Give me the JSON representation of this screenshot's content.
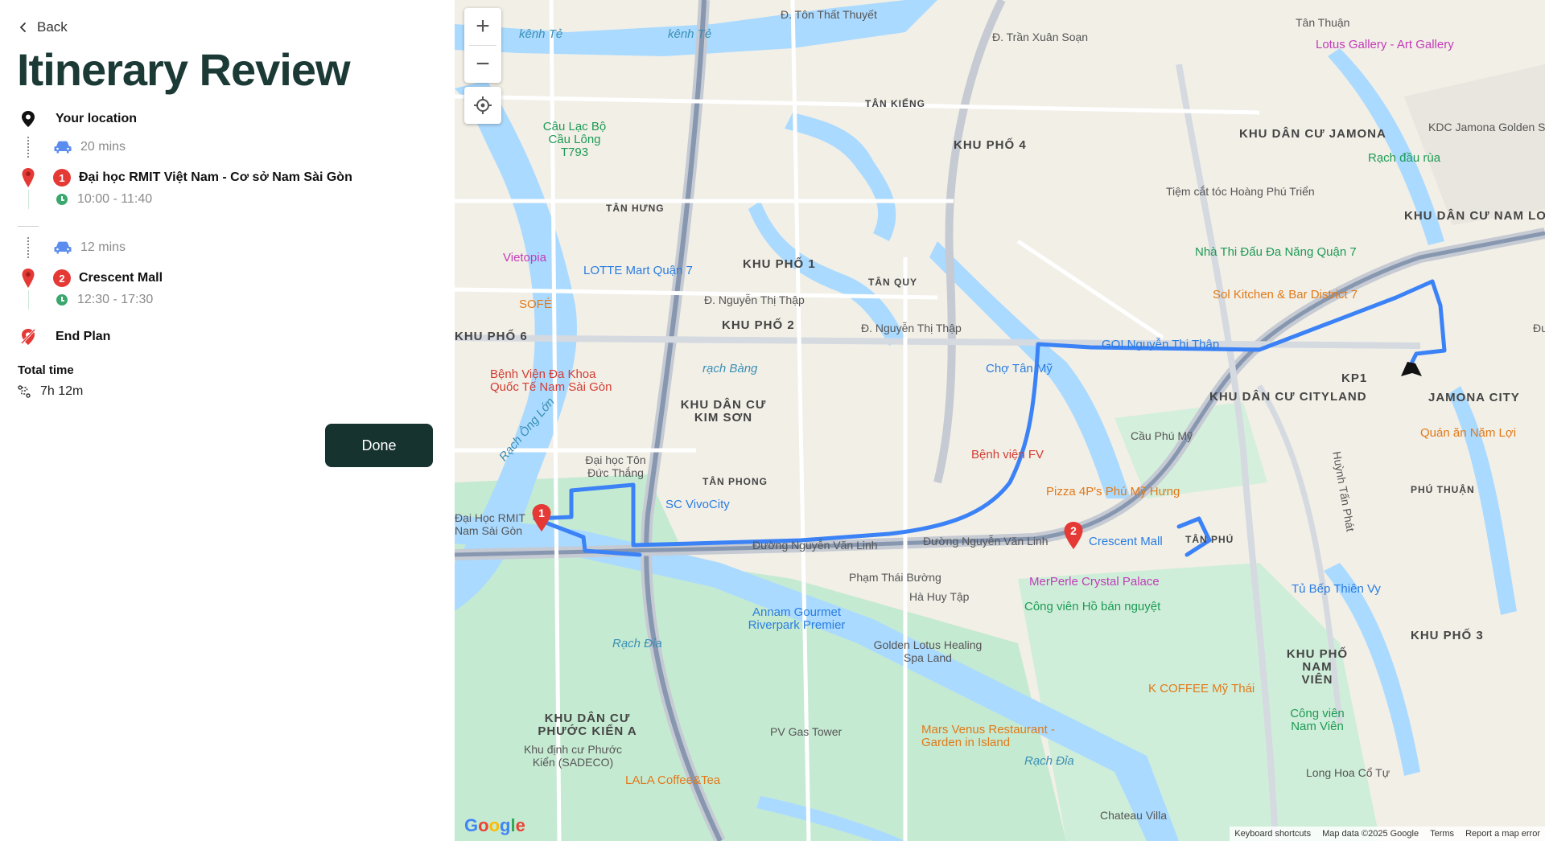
{
  "header": {
    "back_label": "Back",
    "title": "Itinerary Review"
  },
  "itinerary": {
    "start_label": "Your location",
    "leg1_duration": "20 mins",
    "stop1": {
      "number": "1",
      "name": "Đại học RMIT Việt Nam - Cơ sở Nam Sài Gòn",
      "time": "10:00 - 11:40"
    },
    "leg2_duration": "12 mins",
    "stop2": {
      "number": "2",
      "name": "Crescent Mall",
      "time": "12:30 - 17:30"
    },
    "end_label": "End Plan"
  },
  "summary": {
    "total_time_label": "Total time",
    "total_time_value": "7h 12m"
  },
  "actions": {
    "done_label": "Done"
  },
  "colors": {
    "title": "#1b3a36",
    "done_button": "#17332f",
    "stop_badge": "#e53935",
    "clock": "#3aa76d",
    "car_icon": "#5b8def",
    "route": "#3b82f6",
    "water": "#aadaff",
    "park": "#c5ead2"
  },
  "map": {
    "zoom_in": "+",
    "zoom_out": "−",
    "google": "Google",
    "attribution": {
      "shortcuts": "Keyboard shortcuts",
      "data": "Map data ©2025 Google",
      "terms": "Terms",
      "report": "Report a map error"
    },
    "labels": {
      "l1": "Đ. Tôn Thất Thuyết",
      "l2": "kênh Tẻ",
      "l3": "kênh Tẻ",
      "l4": "Đ. Trần Xuân Soạn",
      "l5": "Tân Thuận",
      "l6": "Lotus Gallery - Art Gallery",
      "l7": "KDC Jamona Golden Silk",
      "l8": "KHU DÂN CƯ JAMONA",
      "l9": "Rạch đầu rùa",
      "l10": "Tiệm cắt tóc Hoàng Phú Triển",
      "l11": "KHU DÂN CƯ NAM LONG",
      "l12": "Nhà Thi Đấu Đa Năng Quận 7",
      "l13": "Sol Kitchen & Bar District 7",
      "l14": "GO! Nguyễn Thị Thập",
      "l15": "JAMONA CITY",
      "l16": "KP1",
      "l17": "Quán ăn Năm Lợi",
      "l18": "KHU DÂN CƯ CITYLAND",
      "l19": "Cầu Phú Mỹ",
      "l20": "Chợ Tân Mỹ",
      "l21": "Bệnh viện FV",
      "l22": "Pizza 4P's Phú Mỹ Hưng",
      "l23": "Crescent Mall",
      "l24": "MerPerle Crystal Palace",
      "l25": "Công viên Hồ bán nguyệt",
      "l26": "Tủ Bếp Thiên Vy",
      "l27": "KHU PHỐ 3",
      "l28": "KHU PHỐ NAM VIÊN",
      "l29": "K COFFEE Mỹ Thái",
      "l30": "Công viên Nam Viên",
      "l31": "Long Hoa Cổ Tự",
      "l32": "Chateau Villa",
      "l33": "Mars Venus Restaurant - Garden in Island",
      "l34": "Rạch Đỉa",
      "l35": "PV Gas Tower",
      "l36": "LALA Coffee&Tea",
      "l37": "Khu định cư Phước Kiển (SADECO)",
      "l38": "KHU DÂN CƯ PHƯỚC KIỂN A",
      "l39": "Golden Lotus Healing Spa Land",
      "l40": "Annam Gourmet Riverpark Premier",
      "l41": "Rạch Đỉa",
      "l42": "SC VivoCity",
      "l43": "Đại học Tôn Đức Thắng",
      "l44": "Đại Học RMIT Nam Sài Gòn",
      "l45": "Bệnh Viện Đa Khoa Quốc Tế Nam Sài Gòn",
      "l46": "KHU PHỐ 6",
      "l47": "SOFÉ",
      "l48": "Vietopia",
      "l49": "LOTTE Mart Quận 7",
      "l50": "Câu Lạc Bộ Cầu Lông T793",
      "l51": "KHU PHỐ 1",
      "l52": "KHU PHỐ 2",
      "l53": "KHU PHỐ 4",
      "l54": "KHU DÂN CƯ KIM SƠN",
      "l55": "Đường Nguyễn Văn Linh",
      "l56": "Đường Nguyễn Văn Linh",
      "l57": "Đ. Nguyễn Thị Thập",
      "l58": "Đ. Nguyễn Thị Thập",
      "l59": "rạch Bàng",
      "l60": "TÂN PHONG",
      "l61": "TÂN KIỂNG",
      "l62": "TÂN QUY",
      "l63": "TÂN HƯNG",
      "l64": "TÂN PHÚ",
      "l65": "PHÚ THUẬN",
      "l66": "Phạm Thái Bường",
      "l67": "Hà Huy Tập",
      "l68": "Đường Nguyễn Văn Linh",
      "l69": "Huỳnh Tấn Phát",
      "l70": "Rạch Ông Lớn"
    }
  }
}
